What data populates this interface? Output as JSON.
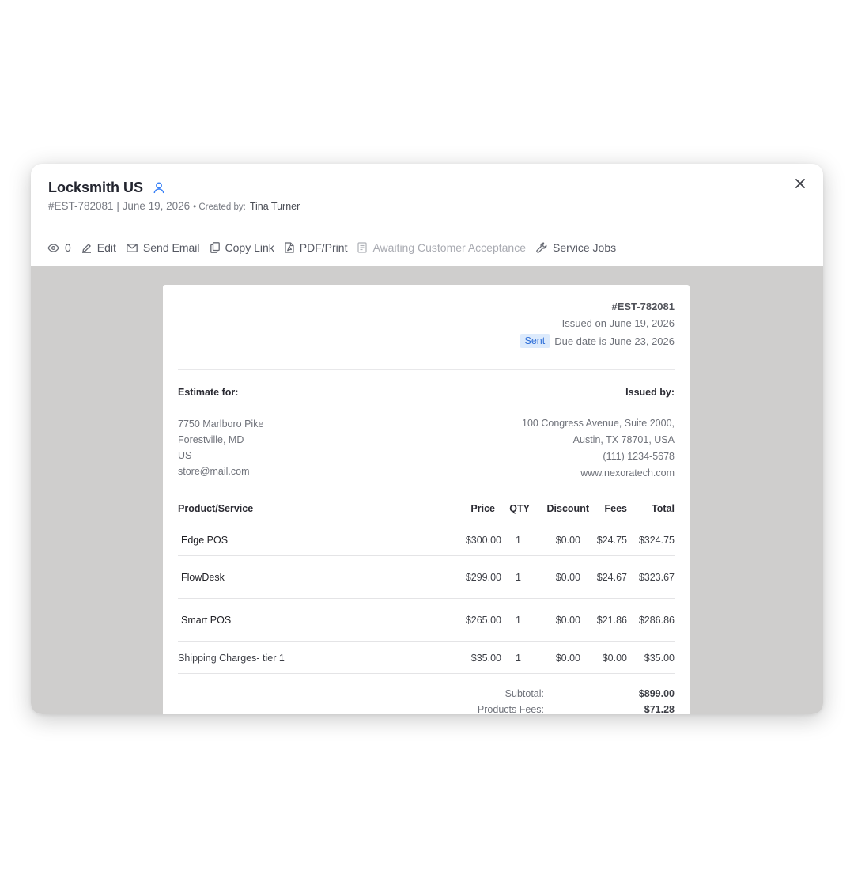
{
  "header": {
    "title": "Locksmith US",
    "estimate_meta": "#EST-782081 | June 19, 2026",
    "created_by_label": "• Created by:",
    "created_by_name": "Tina Turner"
  },
  "toolbar": {
    "views_count": "0",
    "edit": "Edit",
    "send_email": "Send Email",
    "copy_link": "Copy Link",
    "pdf_print": "PDF/Print",
    "awaiting": "Awaiting Customer Acceptance",
    "service_jobs": "Service Jobs"
  },
  "document": {
    "number": "#EST-782081",
    "issued_on": "Issued on June 19, 2026",
    "status_badge": "Sent",
    "due_date": "Due date is June 23, 2026",
    "estimate_for_label": "Estimate for:",
    "issued_by_label": "Issued by:",
    "customer_address": [
      "7750 Marlboro Pike",
      "Forestville, MD",
      "US",
      "store@mail.com"
    ],
    "issuer_address": [
      "100 Congress Avenue, Suite 2000,",
      "Austin, TX 78701, USA",
      "(111) 1234-5678",
      "www.nexoratech.com"
    ],
    "columns": {
      "product": "Product/Service",
      "price": "Price",
      "qty": "QTY",
      "discount": "Discount",
      "fees": "Fees",
      "total": "Total"
    },
    "items": [
      {
        "name": "Edge POS",
        "price": "$300.00",
        "qty": "1",
        "discount": "$0.00",
        "fees": "$24.75",
        "total": "$324.75"
      },
      {
        "name": "FlowDesk",
        "price": "$299.00",
        "qty": "1",
        "discount": "$0.00",
        "fees": "$24.67",
        "total": "$323.67"
      },
      {
        "name": "Smart POS",
        "price": "$265.00",
        "qty": "1",
        "discount": "$0.00",
        "fees": "$21.86",
        "total": "$286.86"
      },
      {
        "name": "Shipping Charges- tier 1",
        "price": "$35.00",
        "qty": "1",
        "discount": "$0.00",
        "fees": "$0.00",
        "total": "$35.00"
      }
    ],
    "subtotal_label": "Subtotal:",
    "subtotal": "$899.00",
    "product_fees_label": "Products Fees:",
    "product_fees": "$71.28"
  },
  "colors": {
    "accent": "#2f6fd8",
    "badge_bg": "#dceafc",
    "content_bg": "#cfcecd"
  },
  "icons": {
    "user": "user-icon",
    "close": "close-icon",
    "eye": "eye-icon",
    "edit": "pencil-icon",
    "email": "envelope-icon",
    "copy": "copy-icon",
    "pdf": "pdf-file-icon",
    "awaiting": "document-icon",
    "service": "wrench-icon"
  }
}
